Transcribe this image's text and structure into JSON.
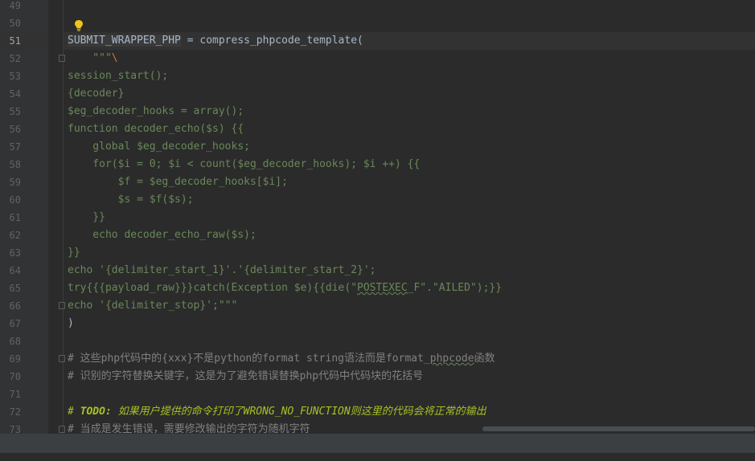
{
  "lines": [
    {
      "n": "49",
      "text": ""
    },
    {
      "n": "50",
      "text": ""
    },
    {
      "n": "51",
      "text": "SUBMIT_WRAPPER_PHP = compress_phpcode_template("
    },
    {
      "n": "52",
      "text": "    \"\"\"\\"
    },
    {
      "n": "53",
      "text": "session_start();"
    },
    {
      "n": "54",
      "text": "{decoder}"
    },
    {
      "n": "55",
      "text": "$eg_decoder_hooks = array();"
    },
    {
      "n": "56",
      "text": "function decoder_echo($s) {{"
    },
    {
      "n": "57",
      "text": "    global $eg_decoder_hooks;"
    },
    {
      "n": "58",
      "text": "    for($i = 0; $i < count($eg_decoder_hooks); $i ++) {{"
    },
    {
      "n": "59",
      "text": "        $f = $eg_decoder_hooks[$i];"
    },
    {
      "n": "60",
      "text": "        $s = $f($s);"
    },
    {
      "n": "61",
      "text": "    }}"
    },
    {
      "n": "62",
      "text": "    echo decoder_echo_raw($s);"
    },
    {
      "n": "63",
      "text": "}}"
    },
    {
      "n": "64",
      "text": "echo '{delimiter_start_1}'.'{delimiter_start_2}';"
    },
    {
      "n": "65",
      "text": "try{{{payload_raw}}}catch(Exception $e){{die(\"POSTEXEC_F\".\"AILED\");}}"
    },
    {
      "n": "66",
      "text": "echo '{delimiter_stop}';\"\"\""
    },
    {
      "n": "67",
      "text": ")"
    },
    {
      "n": "68",
      "text": ""
    },
    {
      "n": "69",
      "text": "# 这些php代码中的{xxx}不是python的format string语法而是format_phpcode函数"
    },
    {
      "n": "70",
      "text": "# 识别的字符替换关键字，这是为了避免错误替换php代码中代码块的花括号"
    },
    {
      "n": "71",
      "text": ""
    },
    {
      "n": "72",
      "text": "# TODO: 如果用户提供的命令打印了WRONG_NO_FUNCTION则这里的代码会将正常的输出"
    },
    {
      "n": "73",
      "text": "# 当成是发生错误，需要修改输出的字符为随机字符"
    }
  ],
  "l51": {
    "ident": "SUBMIT_WRAPPER_PHP",
    "rest": " = compress_phpcode_template("
  },
  "l52": {
    "quote": "    \"\"\"",
    "esc": "\\"
  },
  "l65": {
    "pre": "try{{{payload_raw}}}catch(Exception $e){{die(\"",
    "typo": "POSTEXEC",
    "post": "_F\".\"AILED\");}}"
  },
  "l69": {
    "pre": "# 这些php代码中的{xxx}不是python的format string语法而是format_",
    "typo": "phpcode",
    "post": "函数"
  },
  "l70": "# 识别的字符替换关键字，这是为了避免错误替换php代码中代码块的花括号",
  "l72": {
    "hash": "# ",
    "todo": "TODO:",
    "text": " 如果用户提供的命令打印了WRONG_NO_FUNCTION则这里的代码会将正常的输出"
  },
  "l73": "# 当成是发生错误，需要修改输出的字符为随机字符",
  "current_line": "51",
  "colors": {
    "background": "#2b2b2b",
    "gutter": "#313335",
    "string": "#6a8759",
    "identifier": "#a9b7c6",
    "comment": "#808080",
    "todo": "#a8c023",
    "escape": "#cc7832",
    "bulb": "#f0c419"
  },
  "icons": [
    "lightbulb-icon",
    "fold-marker-icon"
  ]
}
